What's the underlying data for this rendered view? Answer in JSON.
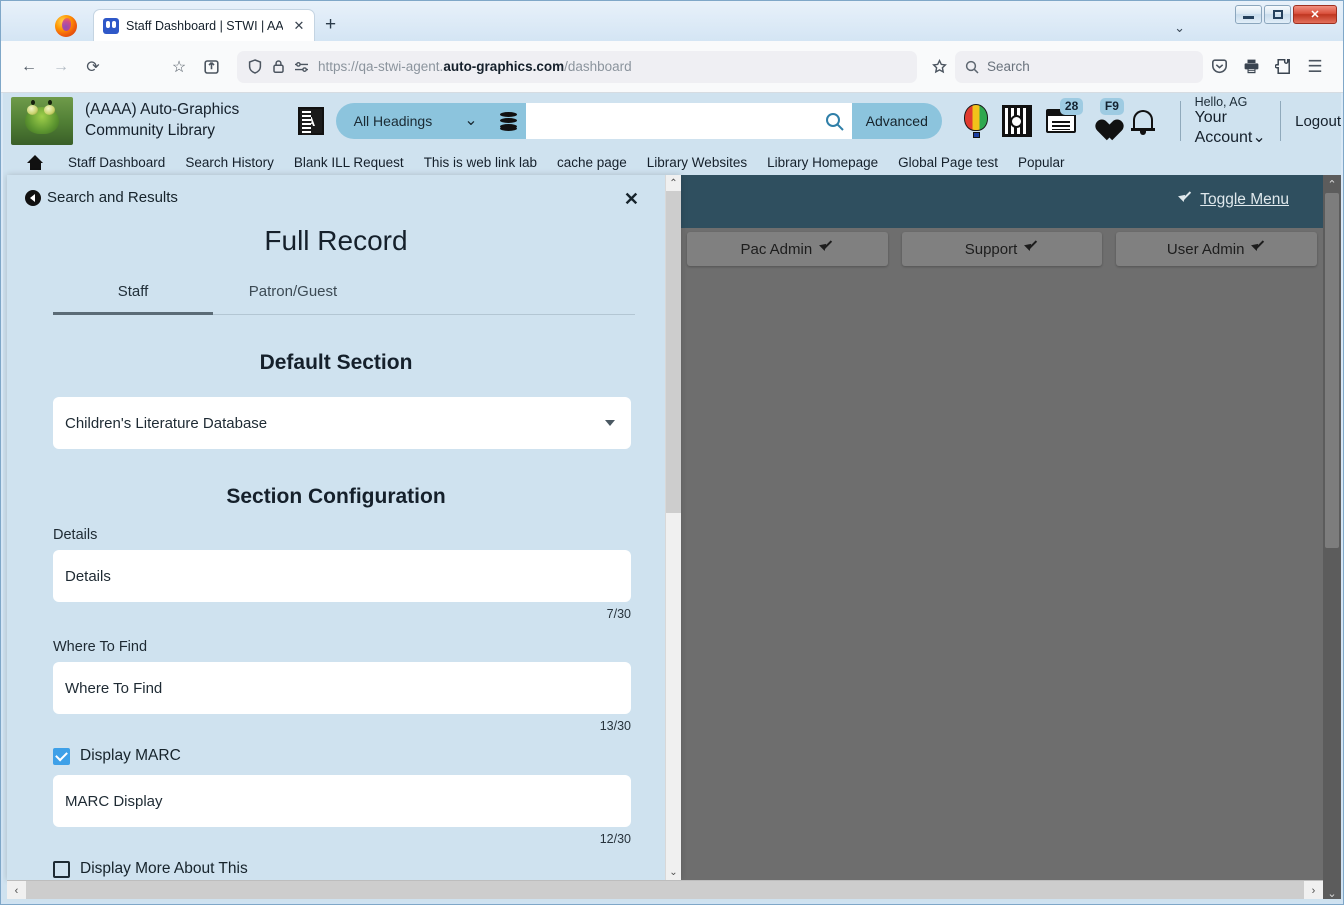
{
  "browser": {
    "tab_title": "Staff Dashboard | STWI | AAAA",
    "tab_close_glyph": "✕",
    "newtab_glyph": "+",
    "tablist_chevron": "⌄",
    "back_glyph": "←",
    "forward_glyph": "→",
    "reload_glyph": "⟳",
    "bookmark_glyph": "☆",
    "save_to_pocket_glyph": "⤡",
    "shield_glyph": "⬡",
    "lock_glyph": "◯",
    "perms_glyph": "⎇",
    "url_prefix": "https://qa-stwi-agent.",
    "url_domain": "auto-graphics.com",
    "url_suffix": "/dashboard",
    "url_full": "https://qa-stwi-agent.auto-graphics.com/dashboard",
    "search_placeholder": "Search",
    "search_icon": "search-icon",
    "pocket_icon": "pocket-icon",
    "print_icon": "print-icon",
    "extensions_icon": "extensions-icon",
    "menu_glyph": "☰",
    "window_controls": {
      "minimize": "minimize-button",
      "maximize": "maximize-button",
      "close": "✕"
    }
  },
  "site": {
    "library_name": "(AAAA) Auto-Graphics Community Library",
    "search": {
      "scope_label": "All Headings",
      "scope_caret": "⌄",
      "query_value": "",
      "advanced_label": "Advanced",
      "search_icon": "search-icon",
      "database_icon": "database-stack-icon",
      "language_icon": "language-translate-icon"
    },
    "header_icons": [
      {
        "name": "hot-air-balloon-icon",
        "badge": ""
      },
      {
        "name": "research-magnifier-icon",
        "badge": ""
      },
      {
        "name": "my-lists-card-icon",
        "badge": "28"
      },
      {
        "name": "favorites-heart-icon",
        "badge": "F9"
      },
      {
        "name": "notifications-bell-icon",
        "badge": ""
      }
    ],
    "account": {
      "hello": "Hello, AG",
      "your_account": "Your Account",
      "your_account_caret": "⌄",
      "logout": "Logout"
    },
    "nav_links": [
      "Staff Dashboard",
      "Search History",
      "Blank ILL Request",
      "This is web link lab",
      "cache page",
      "Library Websites",
      "Library Homepage",
      "Global Page test",
      "Popular"
    ],
    "home_icon": "home-icon"
  },
  "right_panel": {
    "toggle_menu_label": "Toggle Menu",
    "toggle_menu_icon": "expand-arrow-icon",
    "admin_buttons": [
      {
        "label": "Pac Admin",
        "icon": "external-link-icon"
      },
      {
        "label": "Support",
        "icon": "external-link-icon"
      },
      {
        "label": "User Admin",
        "icon": "external-link-icon"
      }
    ],
    "scroll_up_glyph": "⌃",
    "scroll_down_glyph": "⌄"
  },
  "modal": {
    "back_label": "Search and Results",
    "back_icon": "back-circle-icon",
    "close_glyph": "✕",
    "title": "Full Record",
    "tabs": [
      {
        "label": "Staff",
        "active": true
      },
      {
        "label": "Patron/Guest",
        "active": false
      }
    ],
    "default_section": {
      "heading": "Default Section",
      "selected": "Children's Literature Database",
      "caret": "▼"
    },
    "section_configuration": {
      "heading": "Section Configuration",
      "fields": [
        {
          "label": "Details",
          "value": "Details",
          "counter": "7/30"
        },
        {
          "label": "Where To Find",
          "value": "Where To Find",
          "counter": "13/30"
        }
      ],
      "marc": {
        "checkbox_label": "Display MARC",
        "checked": true,
        "value": "MARC Display",
        "counter": "12/30"
      },
      "more_about_this": {
        "checkbox_label": "Display More About This",
        "checked": false
      }
    },
    "scroll_up_glyph": "⌃",
    "scroll_down_glyph": "⌄",
    "hscroll_left_glyph": "‹",
    "hscroll_right_glyph": "›"
  },
  "colors": {
    "page_bg": "#cfe2ef",
    "accent_blue": "#8cc4dd",
    "teal_header": "#2f4f5f",
    "dim_overlay": "#6e6e6e",
    "checkbox_checked": "#3ea0e8",
    "close_button_red": "#bf3620"
  }
}
